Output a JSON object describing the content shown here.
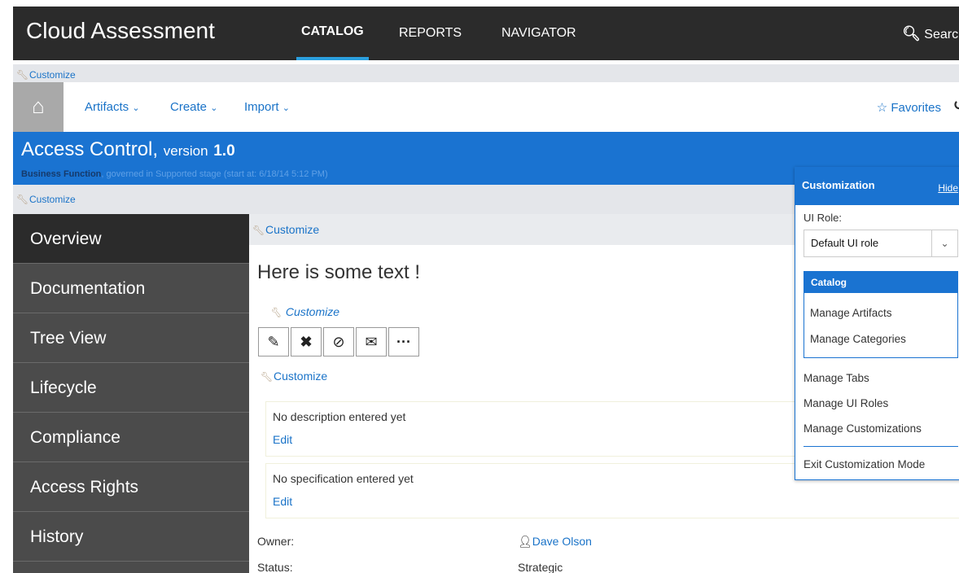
{
  "topbar": {
    "brand": "Cloud Assessment",
    "nav": [
      "CATALOG",
      "REPORTS",
      "NAVIGATOR"
    ],
    "search": "Search"
  },
  "customize_label": "Customize",
  "subnav": {
    "items": [
      "Artifacts",
      "Create",
      "Import"
    ],
    "favorites": "Favorites"
  },
  "header": {
    "title": "Access Control,",
    "version_prefix": "version",
    "version": "1.0",
    "function": "Business Function",
    "governed": ", governed in Supported stage (start at: 6/18/14 5:12 PM)"
  },
  "sidebar": [
    "Overview",
    "Documentation",
    "Tree View",
    "Lifecycle",
    "Compliance",
    "Access Rights",
    "History"
  ],
  "main": {
    "headline": "Here is some text !",
    "description": "No description entered yet",
    "specification": "No specification entered yet",
    "edit": "Edit",
    "owner_label": "Owner:",
    "owner": "Dave Olson",
    "status_label": "Status:",
    "status": "Strategic"
  },
  "panel": {
    "title": "Customization",
    "hide": "Hide",
    "ui_role_label": "UI Role:",
    "ui_role_value": "Default UI role",
    "catalog_head": "Catalog",
    "manage_artifacts": "Manage Artifacts",
    "manage_categories": "Manage Categories",
    "manage_tabs": "Manage Tabs",
    "manage_ui_roles": "Manage UI Roles",
    "manage_customizations": "Manage Customizations",
    "exit": "Exit Customization Mode"
  }
}
